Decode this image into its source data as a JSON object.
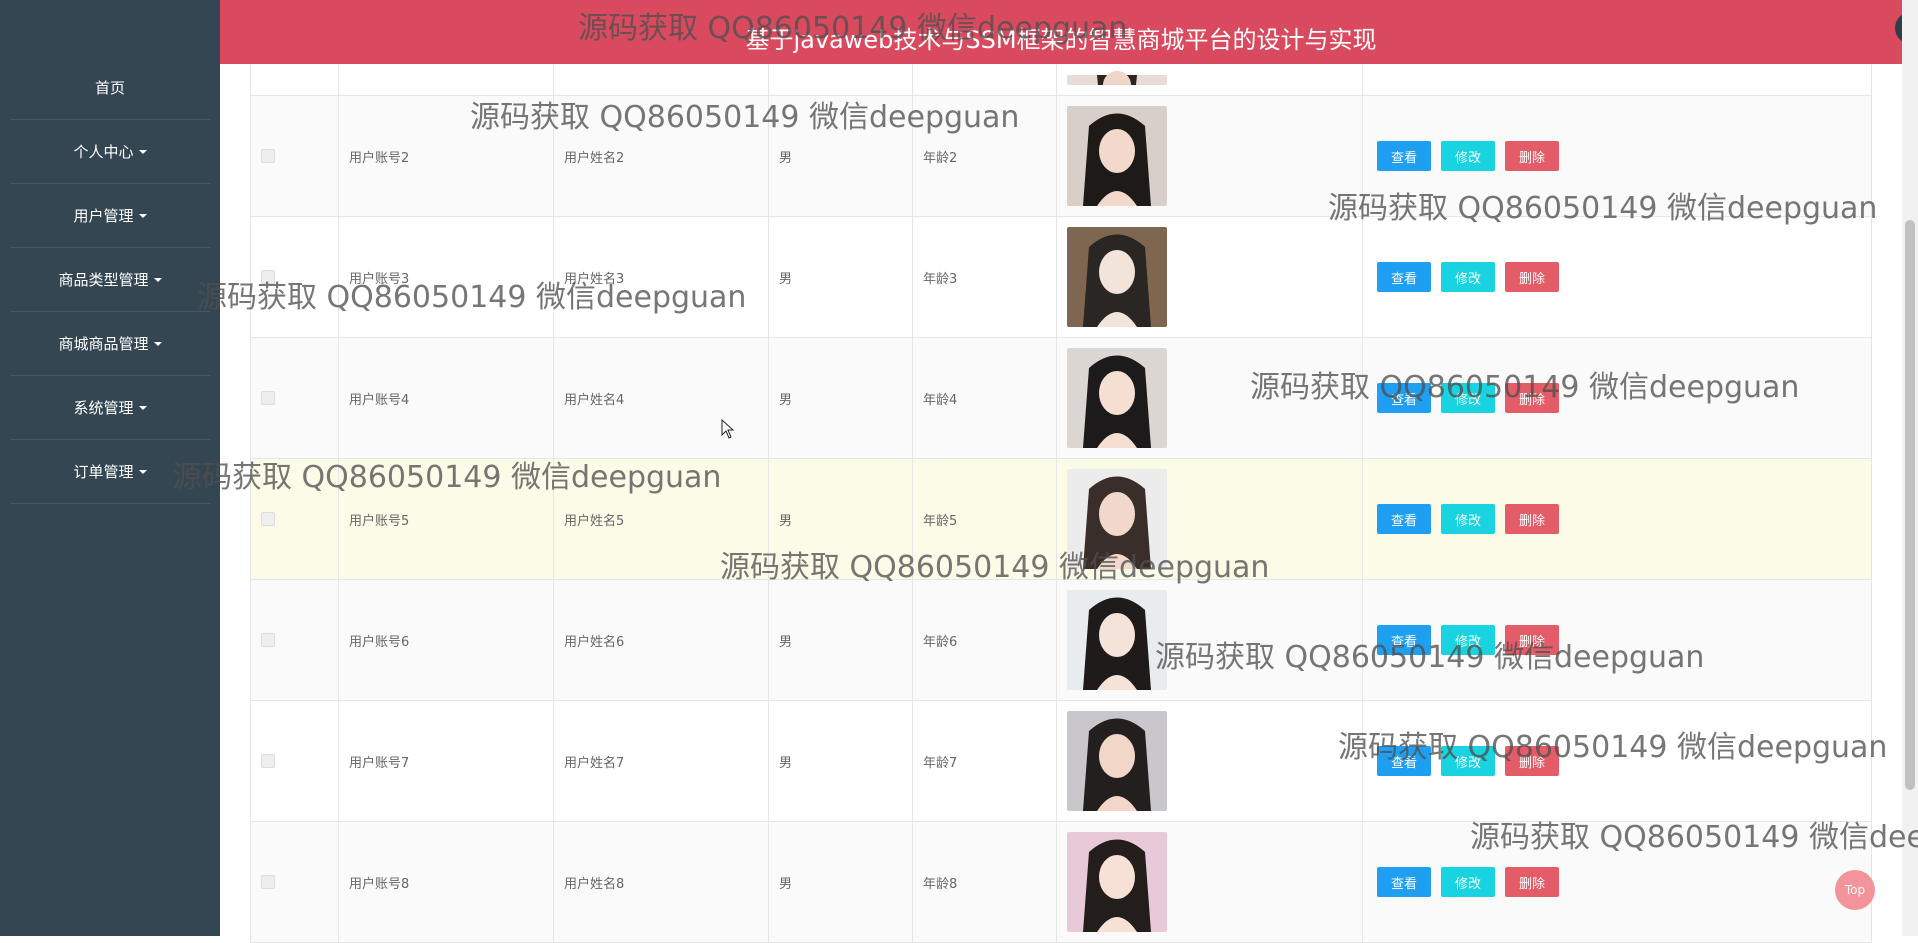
{
  "header": {
    "title": "基于javaweb技术与SSM框架的智慧商城平台的设计与实现",
    "fullscreen_icon": "fullscreen-icon",
    "user_icon": "user-icon",
    "colors": {
      "bar": "#d94a5f",
      "fullscreen_bg": "#2f3f4a",
      "user_bg": "#f5b921"
    }
  },
  "sidebar": {
    "items": [
      {
        "label": "首页",
        "dropdown": false
      },
      {
        "label": "个人中心",
        "dropdown": true
      },
      {
        "label": "用户管理",
        "dropdown": true
      },
      {
        "label": "商品类型管理",
        "dropdown": true
      },
      {
        "label": "商城商品管理",
        "dropdown": true
      },
      {
        "label": "系统管理",
        "dropdown": true
      },
      {
        "label": "订单管理",
        "dropdown": true
      }
    ]
  },
  "table": {
    "rows": [
      {
        "account": "",
        "name": "",
        "sex": "",
        "age": ""
      },
      {
        "account": "用户账号2",
        "name": "用户姓名2",
        "sex": "男",
        "age": "年龄2"
      },
      {
        "account": "用户账号3",
        "name": "用户姓名3",
        "sex": "男",
        "age": "年龄3"
      },
      {
        "account": "用户账号4",
        "name": "用户姓名4",
        "sex": "男",
        "age": "年龄4"
      },
      {
        "account": "用户账号5",
        "name": "用户姓名5",
        "sex": "男",
        "age": "年龄5"
      },
      {
        "account": "用户账号6",
        "name": "用户姓名6",
        "sex": "男",
        "age": "年龄6"
      },
      {
        "account": "用户账号7",
        "name": "用户姓名7",
        "sex": "男",
        "age": "年龄7"
      },
      {
        "account": "用户账号8",
        "name": "用户姓名8",
        "sex": "男",
        "age": "年龄8"
      }
    ],
    "actions": {
      "view": "查看",
      "edit": "修改",
      "delete": "删除"
    }
  },
  "watermark": {
    "text": "源码获取 QQ86050149 微信deepguan"
  },
  "back_to_top": {
    "label": "Top"
  }
}
